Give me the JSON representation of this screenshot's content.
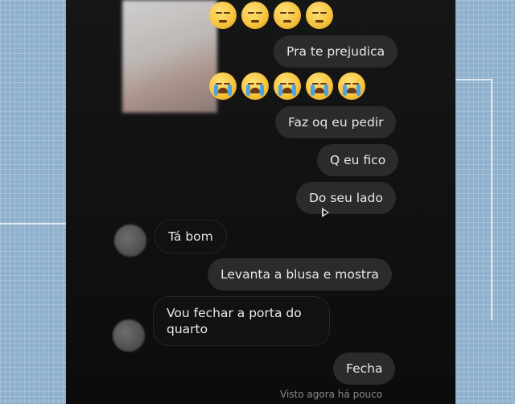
{
  "conversation": {
    "messages": [
      {
        "text": "Pra te prejudica",
        "from": "other"
      },
      {
        "text": "Faz oq eu pedir",
        "from": "other"
      },
      {
        "text": "Q eu fico",
        "from": "other"
      },
      {
        "text": "Do seu lado",
        "from": "other"
      },
      {
        "text": "Tá bom",
        "from": "user"
      },
      {
        "text": "Levanta a blusa e mostra",
        "from": "other"
      },
      {
        "text": "Vou fechar a porta do quarto",
        "from": "user"
      },
      {
        "text": "Fecha",
        "from": "other"
      }
    ],
    "seen_status": "Visto agora há pouco"
  },
  "icons": {
    "sad_emoji": "pensive-face-icon",
    "crying_emoji": "loudly-crying-face-icon",
    "play": "play-icon"
  },
  "colors": {
    "background": "#8fb0cc",
    "chat_background": "#121212",
    "bubble": "#2b2b2d",
    "text": "#e8e8e8",
    "seen_text": "#8a8a8a"
  }
}
